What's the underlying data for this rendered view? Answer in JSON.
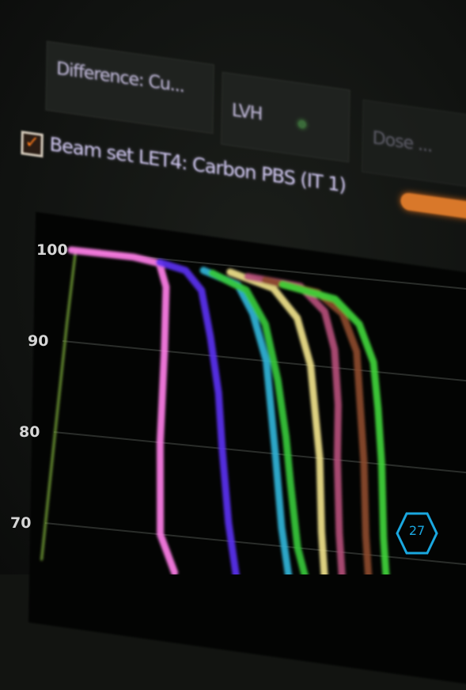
{
  "toolbar": {
    "difference_label": "Difference: Cu...",
    "lvh_label": "LVH",
    "right_label": "Dose ..."
  },
  "beamset": {
    "checked": true,
    "label": "Beam set LET4: Carbon PBS (IT 1)"
  },
  "badge": {
    "number": "27"
  },
  "colors": {
    "accent_orange": "#d9782a",
    "checkbox_check": "#ff7a1a",
    "badge_blue": "#1aa8e0"
  },
  "chart_data": {
    "type": "line",
    "title": "",
    "xlabel": "",
    "ylabel": "",
    "y_ticks": [
      "100",
      "90",
      "80",
      "70"
    ],
    "ylim": [
      66,
      100
    ],
    "xlim": [
      0,
      100
    ],
    "grid": true,
    "series": [
      {
        "color": "#7aa83a",
        "x": [
          0,
          0.3,
          0.6,
          1.0
        ],
        "y": [
          66,
          80,
          92,
          100
        ]
      },
      {
        "color": "#ff7ee8",
        "x": [
          0,
          14,
          20,
          22,
          23,
          24,
          26,
          30
        ],
        "y": [
          100,
          99.9,
          99.5,
          97,
          90,
          80,
          70,
          66
        ]
      },
      {
        "color": "#5a2ff0",
        "x": [
          20,
          26,
          30,
          33,
          36,
          38,
          41,
          44
        ],
        "y": [
          99.6,
          99,
          97,
          92,
          86,
          80,
          72,
          66
        ]
      },
      {
        "color": "#2fb4d8",
        "x": [
          30,
          38,
          42,
          46,
          48,
          50,
          53,
          56
        ],
        "y": [
          99.2,
          98,
          95,
          90,
          85,
          80,
          72,
          66
        ]
      },
      {
        "color": "#36c83a",
        "x": [
          32,
          40,
          45,
          49,
          52,
          54,
          57,
          60
        ],
        "y": [
          99.0,
          97.5,
          94,
          88,
          82,
          77,
          70,
          66
        ]
      },
      {
        "color": "#f0e28a",
        "x": [
          36,
          46,
          52,
          56,
          58,
          60,
          62,
          64
        ],
        "y": [
          99.3,
          98,
          95,
          90,
          85,
          80,
          72,
          66
        ]
      },
      {
        "color": "#b44f7a",
        "x": [
          40,
          52,
          58,
          61,
          63,
          64,
          66,
          68
        ],
        "y": [
          99.0,
          98.5,
          96,
          92,
          86,
          80,
          72,
          66
        ]
      },
      {
        "color": "#8b4a2a",
        "x": [
          44,
          56,
          62,
          66,
          68,
          70,
          72,
          74
        ],
        "y": [
          98.8,
          98,
          96,
          92,
          86,
          80,
          72,
          66
        ]
      },
      {
        "color": "#3fd43a",
        "x": [
          48,
          60,
          66,
          70,
          72,
          74,
          76,
          78
        ],
        "y": [
          98.5,
          97.5,
          95,
          91,
          86,
          80,
          72,
          66
        ]
      }
    ]
  }
}
